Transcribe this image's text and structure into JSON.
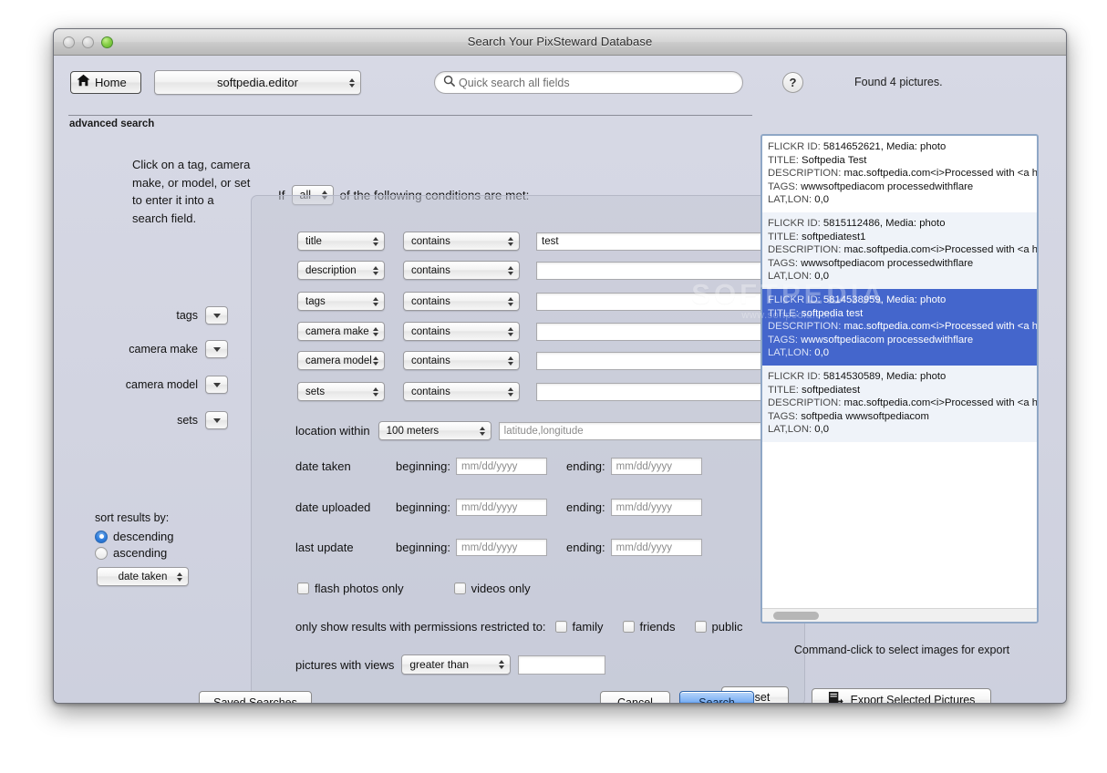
{
  "window": {
    "title": "Search Your PixSteward Database",
    "traffic_lights": [
      "close",
      "minimize",
      "zoom"
    ]
  },
  "toolbar": {
    "home_label": "Home",
    "account": "softpedia.editor",
    "search_placeholder": "Quick search all fields",
    "help_label": "?",
    "found_text": "Found 4 pictures."
  },
  "advanced": {
    "section_label": "advanced search",
    "if_prefix": "If",
    "match_value": "all",
    "if_suffix": "of the following conditions are met:"
  },
  "sidebar": {
    "hint": "Click on a tag, camera make, or model, or set to enter it into a search field.",
    "pickers": [
      {
        "label": "tags"
      },
      {
        "label": "camera make"
      },
      {
        "label": "camera model"
      },
      {
        "label": "sets"
      }
    ],
    "sort_title": "sort results by:",
    "sort_descending": "descending",
    "sort_ascending": "ascending",
    "sort_selected": "descending",
    "sort_field": "date taken"
  },
  "conditions": [
    {
      "field": "title",
      "operator": "contains",
      "value": "test"
    },
    {
      "field": "description",
      "operator": "contains",
      "value": ""
    },
    {
      "field": "tags",
      "operator": "contains",
      "value": ""
    },
    {
      "field": "camera make",
      "operator": "contains",
      "value": ""
    },
    {
      "field": "camera model",
      "operator": "contains",
      "value": ""
    },
    {
      "field": "sets",
      "operator": "contains",
      "value": ""
    }
  ],
  "location": {
    "label": "location within",
    "radius": "100 meters",
    "placeholder": "latitude,longitude",
    "value": ""
  },
  "date_ranges": [
    {
      "label": "date taken",
      "beginning_label": "beginning:",
      "beginning_placeholder": "mm/dd/yyyy",
      "ending_label": "ending:",
      "ending_placeholder": "mm/dd/yyyy"
    },
    {
      "label": "date uploaded",
      "beginning_label": "beginning:",
      "beginning_placeholder": "mm/dd/yyyy",
      "ending_label": "ending:",
      "ending_placeholder": "mm/dd/yyyy"
    },
    {
      "label": "last update",
      "beginning_label": "beginning:",
      "beginning_placeholder": "mm/dd/yyyy",
      "ending_label": "ending:",
      "ending_placeholder": "mm/dd/yyyy"
    }
  ],
  "toggles": {
    "flash_only": "flash photos only",
    "videos_only": "videos only"
  },
  "permissions": {
    "label": "only show results with permissions restricted to:",
    "options": [
      "family",
      "friends",
      "public"
    ]
  },
  "views": {
    "label": "pictures with views",
    "operator": "greater than",
    "value": ""
  },
  "buttons": {
    "reset": "Reset",
    "saved_searches": "Saved Searches",
    "cancel": "Cancel",
    "search": "Search",
    "export": "Export Selected Pictures"
  },
  "results": {
    "hint": "Command-click to select images for export",
    "items": [
      {
        "id_label": "FLICKR ID:",
        "id": "5814652621, Media: photo",
        "title_label": "TITLE:",
        "title": "Softpedia Test",
        "desc_label": "DESCRIPTION:",
        "desc": "mac.softpedia.com<i>Processed with <a hr",
        "tags_label": "TAGS:",
        "tags": "wwwsoftpediacom processedwithflare",
        "latlon_label": "LAT,LON:",
        "latlon": "0,0",
        "selected": false
      },
      {
        "id_label": "FLICKR ID:",
        "id": "5815112486, Media: photo",
        "title_label": "TITLE:",
        "title": "softpediatest1",
        "desc_label": "DESCRIPTION:",
        "desc": "mac.softpedia.com<i>Processed with <a hr",
        "tags_label": "TAGS:",
        "tags": "wwwsoftpediacom processedwithflare",
        "latlon_label": "LAT,LON:",
        "latlon": "0,0",
        "selected": false
      },
      {
        "id_label": "FLICKR ID:",
        "id": "5814538959, Media: photo",
        "title_label": "TITLE:",
        "title": "softpedia test",
        "desc_label": "DESCRIPTION:",
        "desc": "mac.softpedia.com<i>Processed with <a hr",
        "tags_label": "TAGS:",
        "tags": "wwwsoftpediacom processedwithflare",
        "latlon_label": "LAT,LON:",
        "latlon": "0,0",
        "selected": true
      },
      {
        "id_label": "FLICKR ID:",
        "id": "5814530589, Media: photo",
        "title_label": "TITLE:",
        "title": "softpediatest",
        "desc_label": "DESCRIPTION:",
        "desc": "mac.softpedia.com<i>Processed with <a hr",
        "tags_label": "TAGS:",
        "tags": "softpedia wwwsoftpediacom",
        "latlon_label": "LAT,LON:",
        "latlon": "0,0",
        "selected": false
      }
    ]
  },
  "watermark": {
    "big": "SOFTPEDIA",
    "small": "www.softpedia.com"
  },
  "colors": {
    "selection_blue": "#4466cc",
    "primary_button_blue": "#5c9cee",
    "window_bg": "#d3d5e2"
  }
}
